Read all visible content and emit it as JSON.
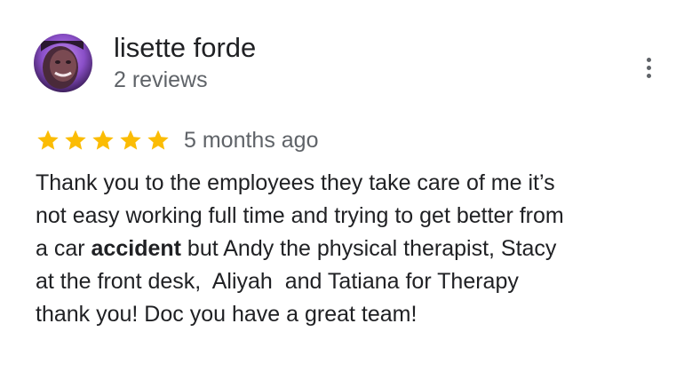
{
  "review": {
    "author": {
      "name": "lisette forde",
      "meta": "2 reviews",
      "avatar_icon": "profile-photo"
    },
    "menu_icon": "more-vert-icon",
    "rating": {
      "value": 5,
      "max": 5,
      "star_color": "#fbbc04"
    },
    "date": "5 months ago",
    "text_lines": [
      {
        "before": "Thank you to the employees they take care of me it’s",
        "bold": "",
        "after": ""
      },
      {
        "before": "not easy working full time and trying to get better from",
        "bold": "",
        "after": ""
      },
      {
        "before": "a car ",
        "bold": "accident",
        "after": " but Andy the physical therapist, Stacy"
      },
      {
        "before": "at the front desk,  Aliyah  and Tatiana for Therapy",
        "bold": "",
        "after": ""
      },
      {
        "before": "thank you! Doc you have a great team!",
        "bold": "",
        "after": ""
      }
    ]
  }
}
